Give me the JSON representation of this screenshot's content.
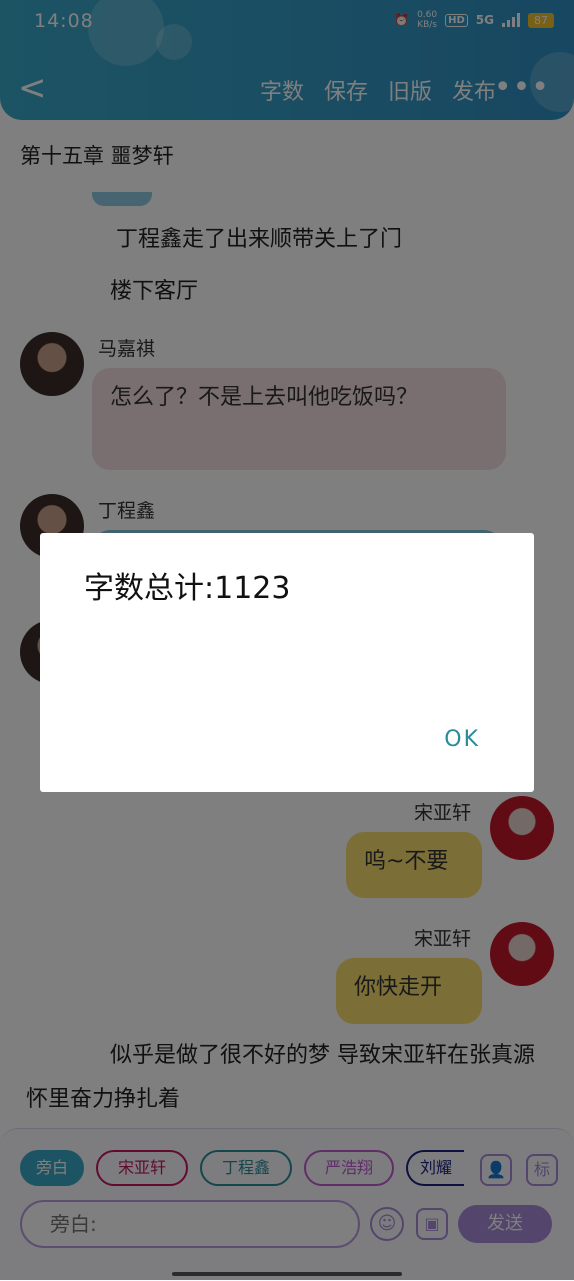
{
  "status_bar": {
    "time": "14:08",
    "net_speed": "0.60",
    "net_unit": "KB/s",
    "hd": "HD",
    "network": "5G",
    "battery": "87"
  },
  "header": {
    "back_icon": "chevron-left-icon",
    "menu": [
      "字数",
      "保存",
      "旧版",
      "发布"
    ],
    "more_icon": "more-dots-icon"
  },
  "chapter_title": "第十五章 噩梦轩",
  "narration": [
    "丁程鑫走了出来顺带关上了门",
    "楼下客厅"
  ],
  "messages": [
    {
      "speaker": "马嘉祺",
      "text": "怎么了？不是上去叫他吃饭吗？"
    },
    {
      "speaker": "丁程鑫",
      "text": ""
    },
    {
      "speaker": "宋亚轩",
      "text": "呜~不要"
    },
    {
      "speaker": "宋亚轩",
      "text": "你快走开"
    }
  ],
  "narration_end": "似乎是做了很不好的梦 导致宋亚轩在张真源怀里奋力挣扎着",
  "chips": [
    "旁白",
    "宋亚轩",
    "丁程鑫",
    "严浩翔",
    "刘耀"
  ],
  "chip_colors": {
    "旁白": "#3aa8c9",
    "宋亚轩": "#c2185b",
    "丁程鑫": "#2a8c99",
    "严浩翔": "#c05ad0",
    "刘耀": "#1a237e"
  },
  "input": {
    "placeholder": "旁白:",
    "send_label": "发送"
  },
  "dialog": {
    "message": "字数总计:1123",
    "ok_label": "OK"
  }
}
